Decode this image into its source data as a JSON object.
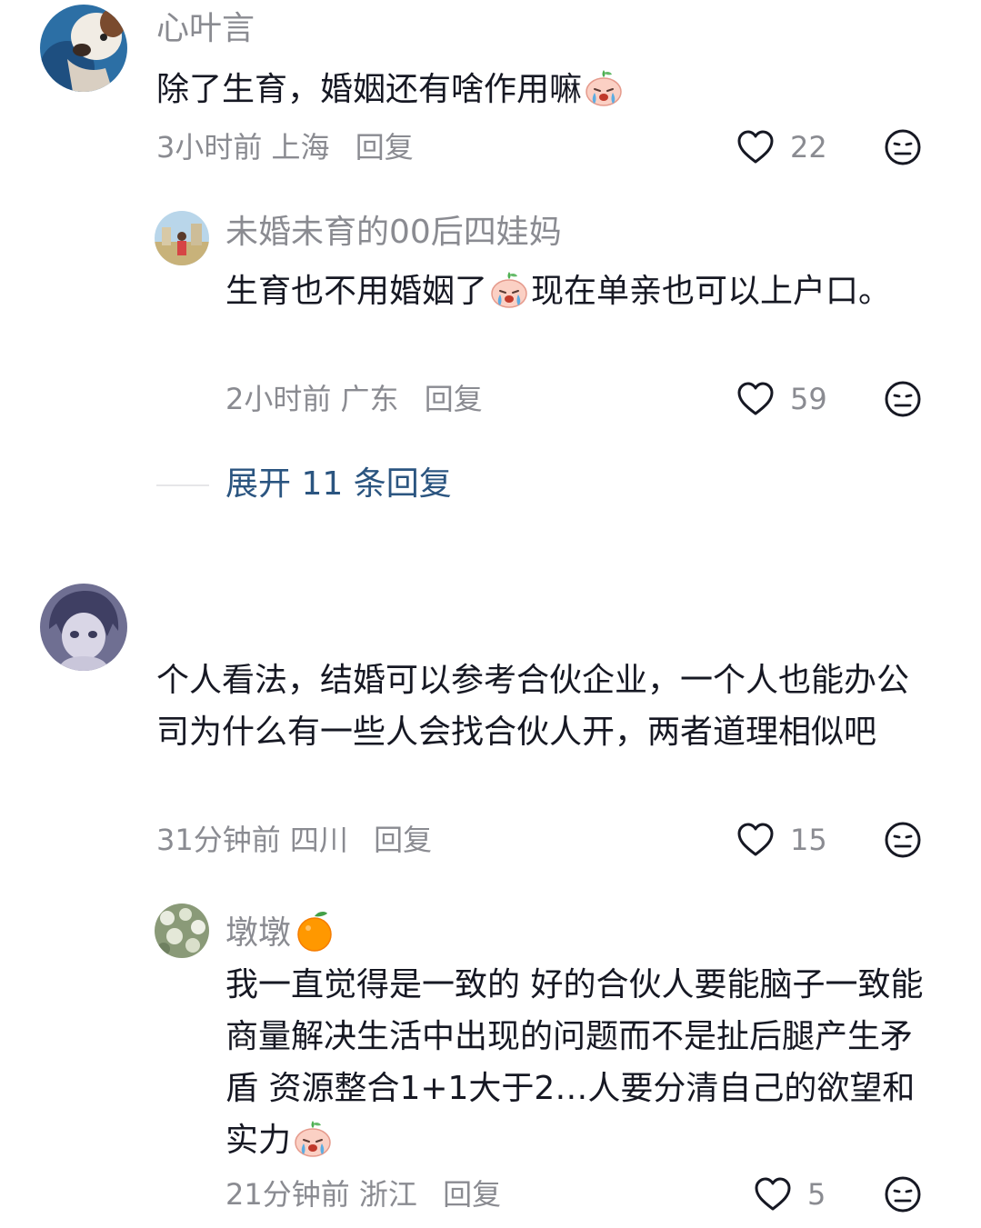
{
  "comments": [
    {
      "username": "心叶言",
      "text_a": "除了生育，婚姻还有啥作用嘛",
      "emoji_a": "crying-face-emoji",
      "time": "3小时前",
      "location": "上海",
      "reply_label": "回复",
      "likes": "22",
      "replies": [
        {
          "username": "未婚未育的00后四娃妈",
          "text_a": "生育也不用婚姻了",
          "emoji_a": "crying-face-emoji",
          "text_b": "现在单亲也可以上户口。",
          "time": "2小时前",
          "location": "广东",
          "reply_label": "回复",
          "likes": "59"
        }
      ],
      "expand_label": "展开 11 条回复"
    },
    {
      "username": "",
      "text_a": "个人看法，结婚可以参考合伙企业，一个人也能办公司为什么有一些人会找合伙人开，两者道理相似吧",
      "time": "31分钟前",
      "location": "四川",
      "reply_label": "回复",
      "likes": "15",
      "replies": [
        {
          "username": "墩墩",
          "username_emoji": "tangerine-emoji",
          "text_a": "我一直觉得是一致的 好的合伙人要能脑子一致能商量解决生活中出现的问题而不是扯后腿产生矛盾 资源整合1+1大于2…人要分清自己的欲望和实力",
          "emoji_a": "crying-face-emoji",
          "time": "21分钟前",
          "location": "浙江",
          "reply_label": "回复",
          "likes": "5"
        }
      ]
    }
  ],
  "colors": {
    "text_primary": "#161823",
    "text_secondary": "#8a8b91",
    "link_blue": "#2b5580"
  }
}
